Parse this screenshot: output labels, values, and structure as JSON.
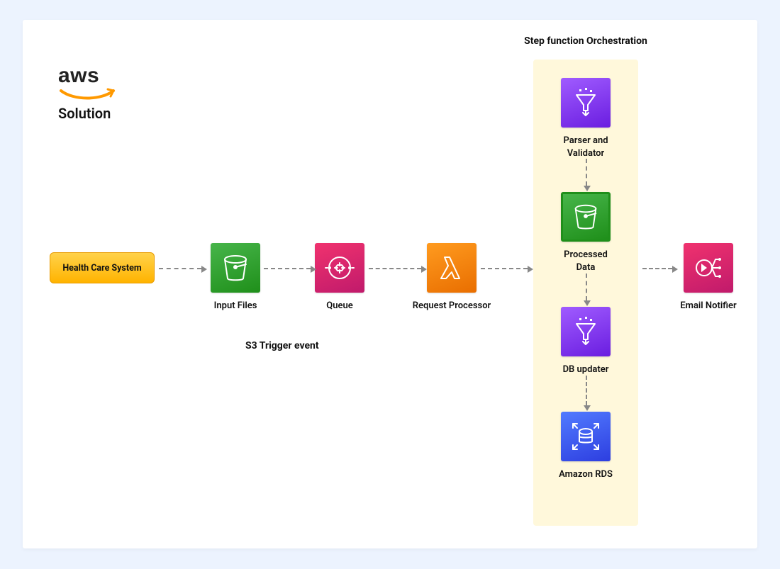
{
  "logo": {
    "word": "aws",
    "sub": "Solution"
  },
  "pill": {
    "label": "Health Care System"
  },
  "nodes": {
    "input": {
      "label": "Input Files"
    },
    "queue": {
      "label": "Queue"
    },
    "processor": {
      "label": "Request Processor"
    },
    "notifier": {
      "label": "Email Notifier"
    }
  },
  "trigger_label": "S3 Trigger event",
  "orchestration": {
    "title": "Step function Orchestration",
    "steps": {
      "parser": {
        "label": "Parser and\nValidator"
      },
      "processed": {
        "label": "Processed\nData"
      },
      "updater": {
        "label": "DB updater"
      },
      "rds": {
        "label": "Amazon RDS"
      }
    }
  }
}
